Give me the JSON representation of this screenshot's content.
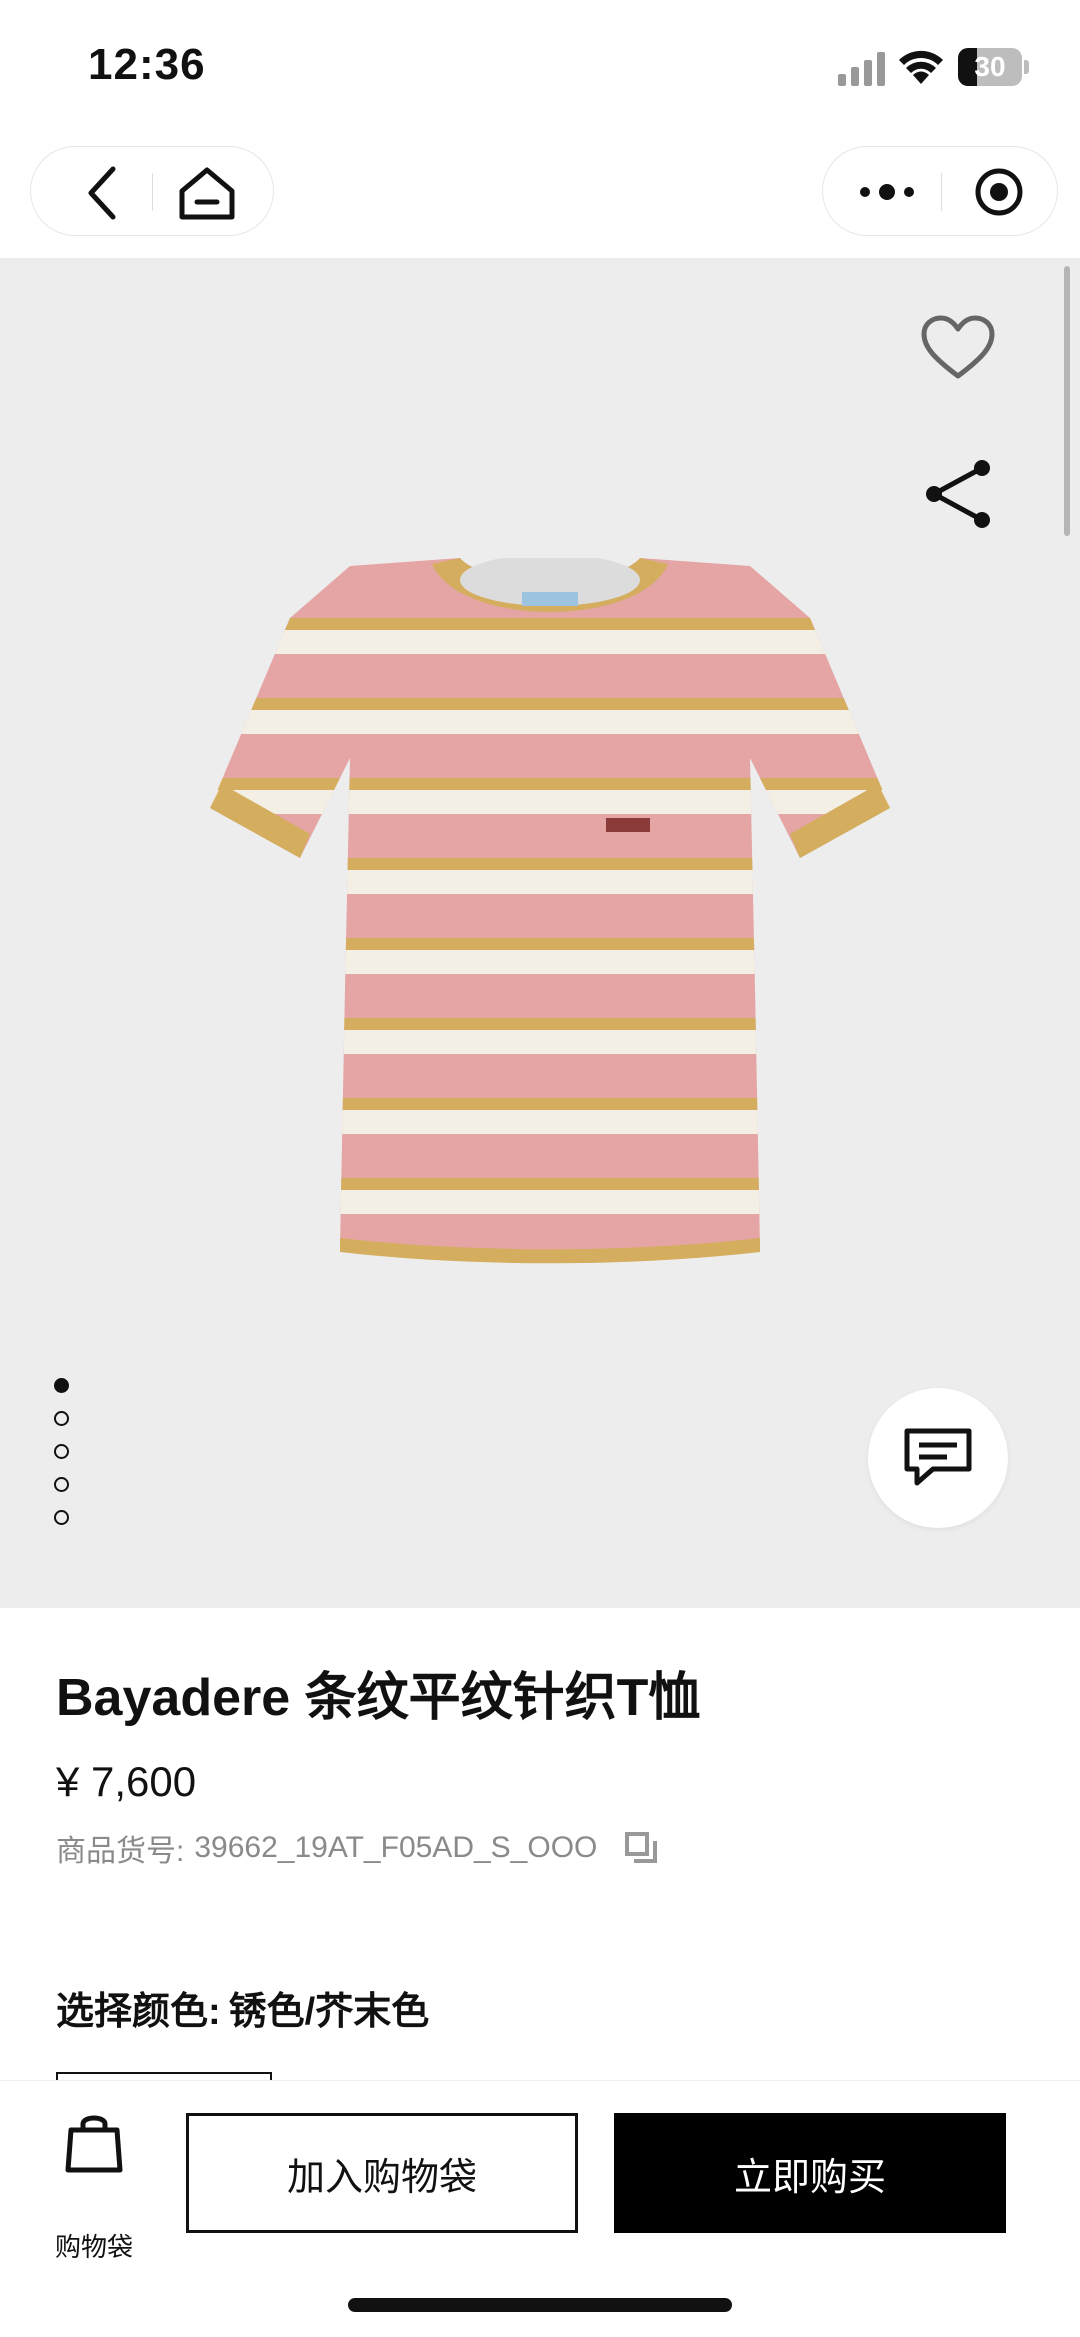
{
  "status_bar": {
    "time": "12:36",
    "battery_level": "30",
    "battery_fraction": 0.3,
    "icons": [
      "signal-icon",
      "wifi-icon",
      "battery-icon"
    ]
  },
  "nav": {
    "icons": [
      "back-icon",
      "home-icon",
      "more-icon",
      "target-icon"
    ]
  },
  "gallery": {
    "image_count": 5,
    "active_index": 0,
    "icons": [
      "heart-icon",
      "share-icon",
      "chat-icon"
    ],
    "colors": {
      "background": "#ededed",
      "pink": "#e2a0a0",
      "mustard": "#d4ae5e",
      "cream": "#f3efe4"
    }
  },
  "product": {
    "title": "Bayadere 条纹平纹针织T恤",
    "price": "¥ 7,600",
    "sku_label": "商品货号:",
    "sku_value": "39662_19AT_F05AD_S_OOO",
    "color_label": "选择颜色:",
    "color_value": "锈色/芥末色"
  },
  "bottom_bar": {
    "bag_label": "购物袋",
    "add_to_bag": "加入购物袋",
    "buy_now": "立即购买",
    "icons": [
      "bag-icon"
    ]
  }
}
